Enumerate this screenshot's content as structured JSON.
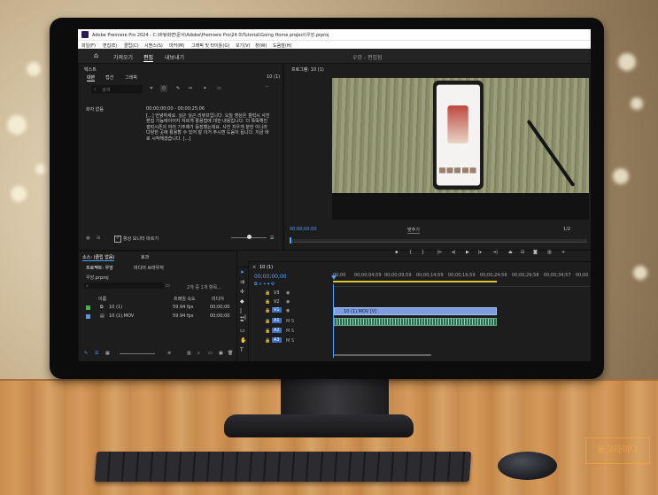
{
  "window": {
    "title": "Adobe Premiere Pro 2024 - C:\\바탕화면\\문서\\Adobe\\Premiere Pro\\24.0\\Tutorial\\Going Home project\\우앙.prproj"
  },
  "menu": [
    "파일(F)",
    "편집(E)",
    "클립(C)",
    "시퀀스(S)",
    "마커(M)",
    "그래픽 및 타이틀(G)",
    "보기(V)",
    "창(W)",
    "도움말(H)"
  ],
  "workspaces": {
    "tabs": [
      "가져오기",
      "편집",
      "내보내기"
    ],
    "active": "편집",
    "center_title": "우앙 - 편집됨"
  },
  "text_panel": {
    "title": "텍스트",
    "tabs": [
      "대본",
      "캡션",
      "그래픽"
    ],
    "active_tab": "대본",
    "sequence_label": "10 (1)",
    "search_placeholder": "검색",
    "speaker": "화자 없음",
    "timecode": "00;00;00;00 - 00;00;25;06",
    "transcript": "[...] 안녕하세요. 실곤 실곤 리뷰프입니다. 오늘 영상은 갤럭시 사진 편집 기능에이어지 자르게 활용법에 대한 내용입니다. 더 똑똑해진 갤럭시폰의 여러 기주제가 등장했는데요. 사진 지우개 분한 이나라 다양한 곳에 활용할 수 있어 잘 이거 주시면 도움이 됩니다. 지금 바로 시작해겠습니다. [...]",
    "follow_label": "항상 모니터 따르기"
  },
  "program_monitor": {
    "title": "프로그램: 10 (1)",
    "timecode": "00;00;00;00",
    "fit": "맞추기",
    "resolution": "1/2"
  },
  "project_panel": {
    "tabs": [
      "소스: (클립 없음)",
      "효과"
    ],
    "subtabs": [
      "프로젝트: 우앙",
      "미디어 브라우저"
    ],
    "project_file": "우앙.prproj",
    "item_count": "2개 중 1개 항목...",
    "columns": [
      "이름",
      "프레임 속도",
      "미디어"
    ],
    "items": [
      {
        "name": "10 (1)",
        "fps": "59.94 fps",
        "media": "00;00;00",
        "color": "#2fbf3a"
      },
      {
        "name": "10 (1).MOV",
        "fps": "59.94 fps",
        "media": "00;00;00",
        "color": "#4f9be8"
      }
    ]
  },
  "timeline": {
    "sequence_tab": "10 (1)",
    "timecode": "00;00;00;00",
    "ruler": [
      "00;00",
      "00;00;04;59",
      "00;00;09;59",
      "00;00;14;59",
      "00;00;19;59",
      "00;00;24;58",
      "00;00;29;58",
      "00;00;34;57",
      "00;00"
    ],
    "tracks": [
      "V3",
      "V2",
      "V1",
      "A1",
      "A2",
      "A3"
    ],
    "video_clip": "10 (1).MOV [V]"
  },
  "watermark": "동그라미다"
}
